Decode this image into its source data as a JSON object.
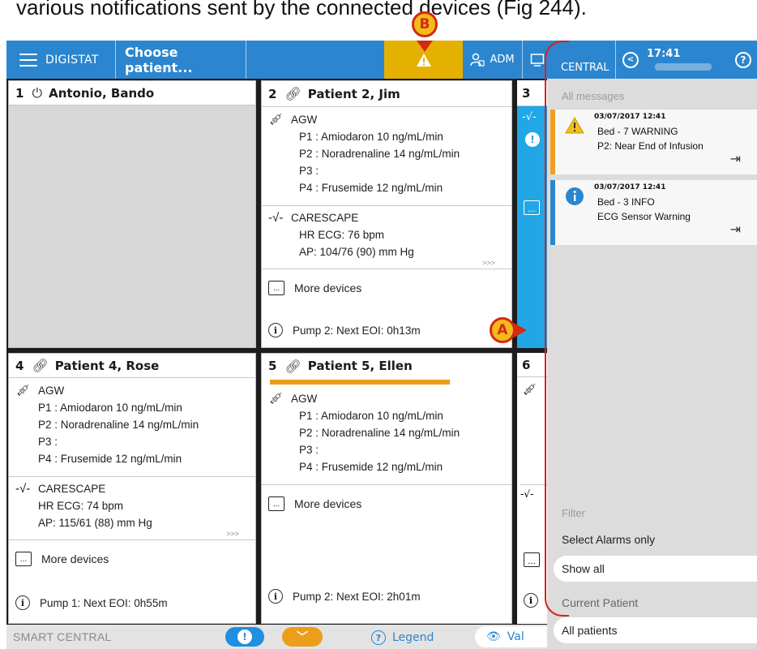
{
  "caption": "various notifications sent by the connected devices (Fig 244).",
  "topbar": {
    "app_name": "DIGISTAT",
    "choose_patient": "Choose patient...",
    "user": "ADM",
    "central": "CENTRAL",
    "time": "17:41",
    "help": "?"
  },
  "callouts": {
    "a": "A",
    "b": "B"
  },
  "beds": [
    {
      "number": "1",
      "name": "Antonio, Bando",
      "icon": "power-icon"
    },
    {
      "number": "2",
      "name": "Patient 2, Jim",
      "icon": "link-icon",
      "pump": {
        "name": "AGW",
        "lines": [
          "P1 : Amiodaron 10  ng/mL/min",
          "P2 : Noradrenaline 14  ng/mL/min",
          "P3 :",
          "P4 : Frusemide 12  ng/mL/min"
        ]
      },
      "monitor": {
        "name": "CARESCAPE",
        "lines": [
          "HR ECG: 76 bpm",
          "AP: 104/76 (90)  mm Hg"
        ],
        "more": ">>>"
      },
      "more_devices": "More devices",
      "eoi": "Pump 2: Next EOI: 0h13m"
    },
    {
      "number": "3"
    },
    {
      "number": "4",
      "name": "Patient 4, Rose",
      "icon": "link-icon",
      "pump": {
        "name": "AGW",
        "lines": [
          "P1 : Amiodaron 10  ng/mL/min",
          "P2 : Noradrenaline 14  ng/mL/min",
          "P3 :",
          "P4 : Frusemide 12  ng/mL/min"
        ]
      },
      "monitor": {
        "name": "CARESCAPE",
        "lines": [
          "HR ECG: 74 bpm",
          "AP: 115/61 (88)  mm Hg"
        ],
        "more": ">>>"
      },
      "more_devices": "More devices",
      "eoi": "Pump 1: Next EOI: 0h55m"
    },
    {
      "number": "5",
      "name": "Patient 5, Ellen",
      "icon": "link-icon",
      "pump": {
        "name": "AGW",
        "lines": [
          "P1 : Amiodaron 10  ng/mL/min",
          "P2 : Noradrenaline 14  ng/mL/min",
          "P3 :",
          "P4 : Frusemide 12  ng/mL/min"
        ]
      },
      "more_devices": "More devices",
      "eoi": "Pump 2: Next EOI: 2h01m"
    },
    {
      "number": "6"
    }
  ],
  "bottombar": {
    "title": "SMART CENTRAL",
    "legend": "Legend",
    "values": "Val"
  },
  "panel": {
    "all_messages": "All messages",
    "notifications": [
      {
        "type": "warning",
        "datetime": "03/07/2017 12:41",
        "line1": "Bed - 7 WARNING",
        "line2": "P2: Near End of Infusion",
        "color": "#f0a020"
      },
      {
        "type": "info",
        "datetime": "03/07/2017 12:41",
        "line1": "Bed - 3 INFO",
        "line2": "ECG Sensor Warning",
        "color": "#2b86cf"
      }
    ],
    "filter": "Filter",
    "select_alarms": "Select Alarms only",
    "show_all": "Show all",
    "current_patient": "Current Patient",
    "all_patients": "All patients"
  },
  "colors": {
    "topbar": "#2b86cf",
    "warning": "#e5b100",
    "alarm_orange": "#ec9d1c",
    "info_blue": "#22a7e6",
    "highlight_red": "#d82020"
  }
}
